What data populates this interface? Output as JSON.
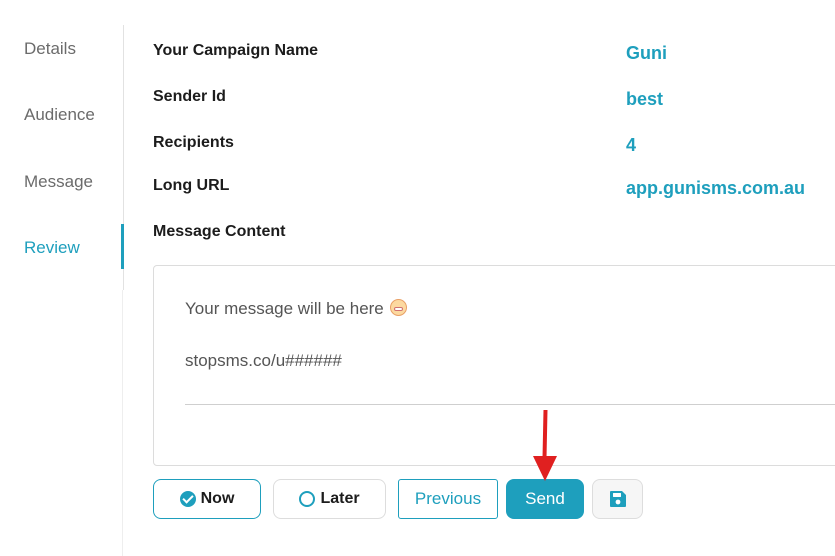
{
  "steps": {
    "details": "Details",
    "audience": "Audience",
    "message": "Message",
    "review": "Review",
    "active": "Review"
  },
  "review": {
    "campaign_name_label": "Your Campaign Name",
    "campaign_name_value": "Guni",
    "sender_id_label": "Sender Id",
    "sender_id_value": "best",
    "recipients_label": "Recipients",
    "recipients_value": "4",
    "long_url_label": "Long URL",
    "long_url_value": "app.gunisms.com.au",
    "message_content_label": "Message Content"
  },
  "message_preview": {
    "body": "Your message will be here",
    "emoji_icon": "grinning-face-emoji",
    "optout": "stopsms.co/u######"
  },
  "actions": {
    "now_label": "Now",
    "now_selected": true,
    "later_label": "Later",
    "previous_label": "Previous",
    "send_label": "Send",
    "save_icon": "floppy-disk-icon"
  },
  "colors": {
    "accent": "#1e9fbd",
    "annotation_arrow": "#e02020"
  }
}
